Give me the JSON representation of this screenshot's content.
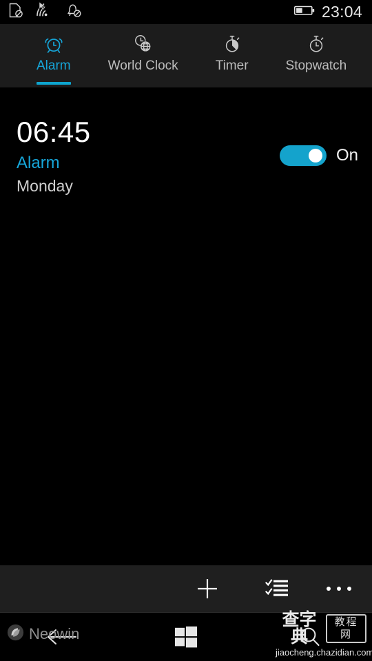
{
  "status_bar": {
    "icons": [
      {
        "name": "sim-card-off-icon",
        "label": "No SIM"
      },
      {
        "name": "wifi-icon",
        "label": "Wi-Fi"
      },
      {
        "name": "notifications-off-icon",
        "label": "Notifications off"
      }
    ],
    "battery": {
      "name": "battery-icon",
      "level_percent": 40
    },
    "time": "23:04"
  },
  "tabs": [
    {
      "label": "Alarm",
      "icon": "alarm-clock-icon",
      "active": true
    },
    {
      "label": "World Clock",
      "icon": "world-clock-icon",
      "active": false
    },
    {
      "label": "Timer",
      "icon": "timer-icon",
      "active": false
    },
    {
      "label": "Stopwatch",
      "icon": "stopwatch-icon",
      "active": false
    }
  ],
  "alarm": {
    "time": "06:45",
    "name": "Alarm",
    "days": "Monday",
    "toggle_state": "On",
    "toggle_on": true
  },
  "command_bar": {
    "add_label": "Add",
    "select_label": "Select",
    "more_label": "More"
  },
  "nav_bar": {
    "back_label": "Back",
    "start_label": "Start",
    "search_label": "Search"
  },
  "watermarks": {
    "neowin": "Neowin",
    "chazidian_cn": "查字典",
    "chazidian_box": "教程网",
    "chazidian_url": "jiaocheng.chazidian.com"
  },
  "colors": {
    "accent": "#16a6d9",
    "toggle_on": "#14a3cc",
    "background": "#000000",
    "chrome": "#1f1f1f"
  }
}
